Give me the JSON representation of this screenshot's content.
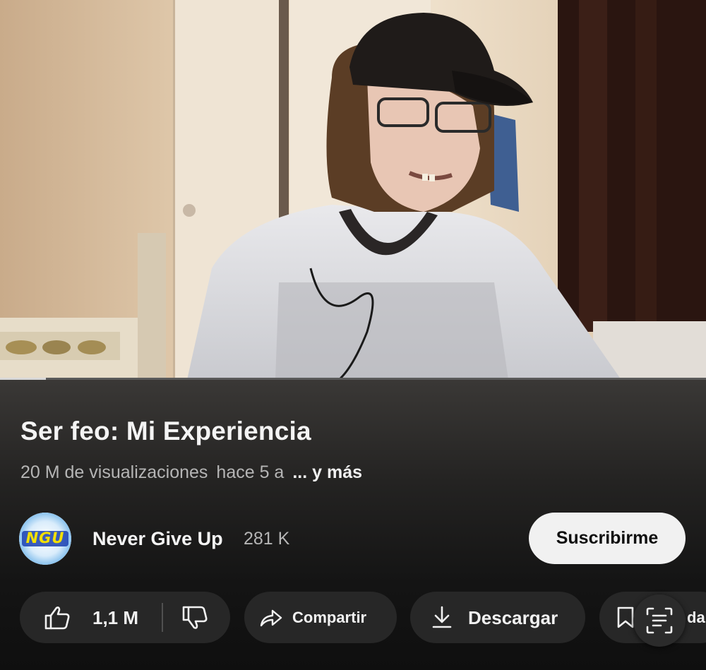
{
  "player": {
    "progress_fraction": 0.065
  },
  "video": {
    "title": "Ser feo: Mi Experiencia",
    "views": "20 M de visualizaciones",
    "age": "hace 5 a",
    "more_label": "... y más"
  },
  "channel": {
    "name": "Never Give Up",
    "subscribers": "281 K",
    "avatar_text": "NGU",
    "subscribe_label": "Suscribirme"
  },
  "actions": {
    "like_count": "1,1 M",
    "share_label": "Compartir",
    "download_label": "Descargar",
    "save_label_partial": "da"
  },
  "icons": {
    "like": "thumbs-up-icon",
    "dislike": "thumbs-down-icon",
    "share": "share-arrow-icon",
    "download": "download-icon",
    "save": "bookmark-icon",
    "transcript": "text-scan-icon"
  },
  "colors": {
    "background": "#0f0f0f",
    "pill": "#272727",
    "subscribe_bg": "#f1f1f1",
    "secondary_text": "#b5b5b5"
  }
}
